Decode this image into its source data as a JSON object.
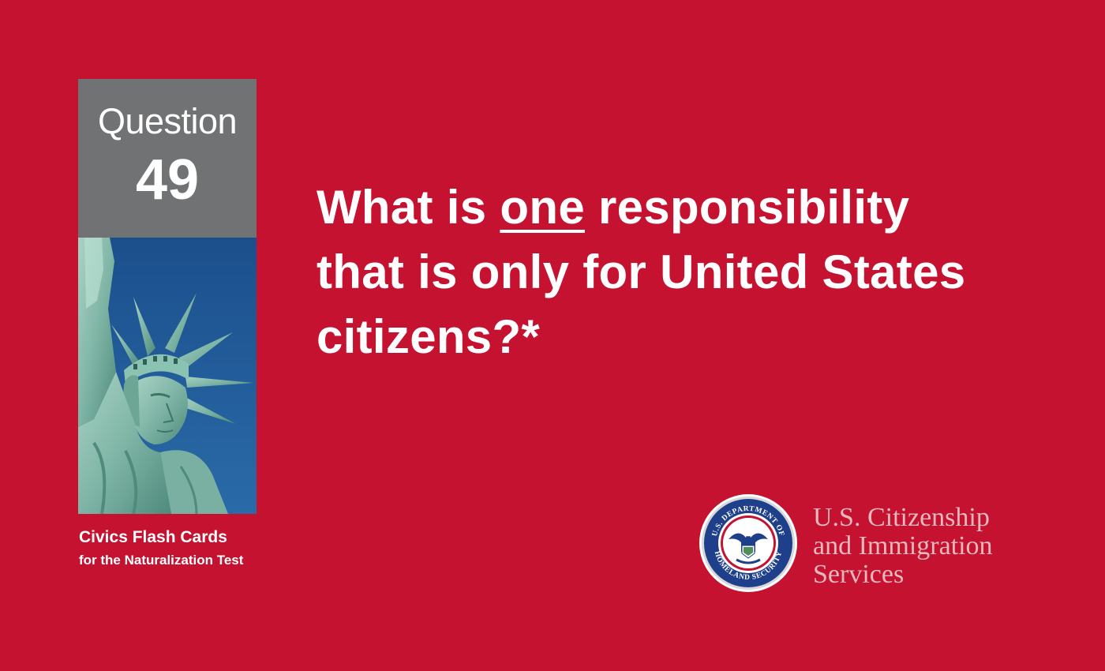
{
  "question_box": {
    "label": "Question",
    "number": "49"
  },
  "caption": {
    "title": "Civics Flash Cards",
    "subtitle": "for the Naturalization Test"
  },
  "question": {
    "line1_before": "What is ",
    "line1_emphasis": "one",
    "line1_after": " responsibility",
    "line2": "that is only for United States",
    "line3": "citizens?*"
  },
  "agency": {
    "line1": "U.S. Citizenship",
    "line2": "and Immigration",
    "line3": "Services",
    "seal_text_top": "U.S. DEPARTMENT OF",
    "seal_text_bottom": "HOMELAND SECURITY"
  },
  "colors": {
    "background": "#c41230",
    "question_box": "#717274",
    "photo_sky": "#1f5a96",
    "agency_text": "#e6b7bd"
  },
  "icons": {
    "photo": "statue-of-liberty-photo",
    "seal": "dhs-seal-icon"
  }
}
